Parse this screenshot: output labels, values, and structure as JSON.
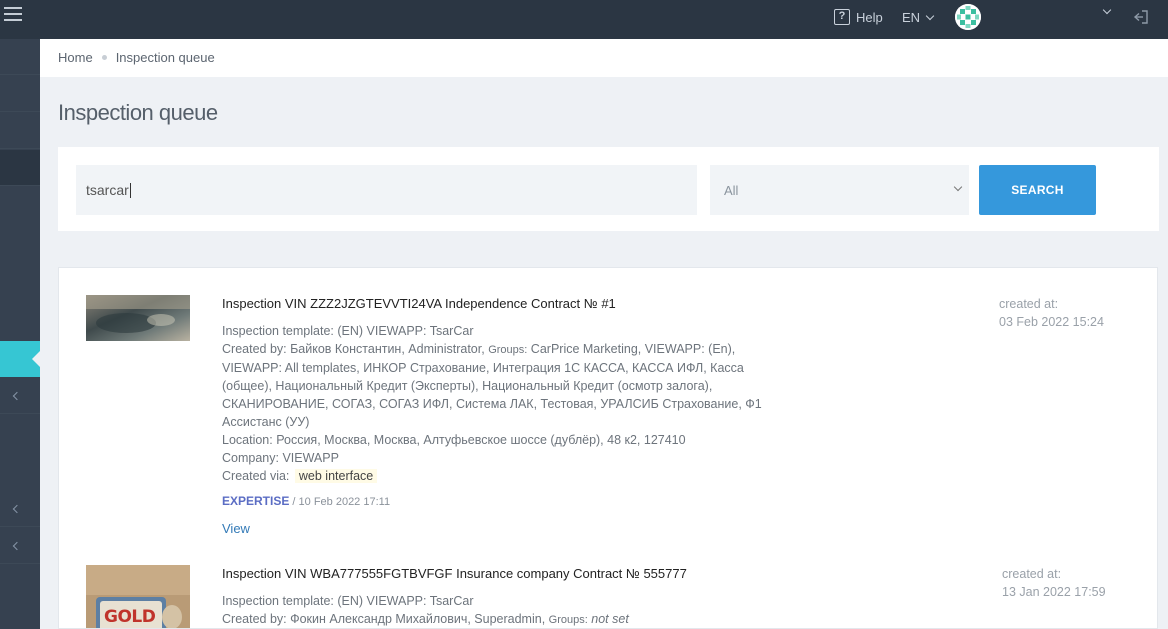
{
  "topbar": {
    "help_label": "Help",
    "lang_label": "EN",
    "icons": [
      "hamburger-icon",
      "help-icon",
      "chevron-down-icon",
      "avatar",
      "logout-icon"
    ]
  },
  "breadcrumb": {
    "home": "Home",
    "current": "Inspection queue"
  },
  "page_title": "Inspection queue",
  "search": {
    "value": "tsarcar",
    "filter_selected": "All",
    "button_label": "SEARCH"
  },
  "results": [
    {
      "title": "Inspection VIN ZZZ2JZGTEVVTI24VA Independence Contract № #1",
      "template": "Inspection template: (EN) VIEWAPP: TsarCar",
      "created_by_prefix": "Created by: Байков Константин, Administrator, ",
      "groups_label": "Groups:",
      "groups_line1": " CarPrice Marketing, VIEWAPP: (En),",
      "groups_line2": "VIEWAPP: All templates, ИНКОР Страхование, Интеграция 1С КАССА, КАССА ИФЛ, Касса",
      "groups_line3": "(общее), Национальный Кредит (Эксперты), Национальный Кредит (осмотр залога),",
      "groups_line4": "СКАНИРОВАНИЕ, СОГАЗ, СОГАЗ ИФЛ, Система ЛАК, Тестовая, УРАЛСИБ Страхование, Ф1",
      "groups_line5": "Ассистанс (УУ)",
      "location": "Location: Россия, Москва, Москва, Алтуфьевское шоссе (дублёр), 48 к2, 127410",
      "company": "Company: VIEWAPP",
      "created_via_label": "Created via:",
      "created_via": "web interface",
      "expertise_label": "EXPERTISE",
      "expertise_date": " / 10 Feb 2022 17:11",
      "view_label": "View",
      "created_at_label": "created at:",
      "created_at": "03 Feb 2022 15:24"
    },
    {
      "title": "Inspection VIN WBA777555FGTBVFGF Insurance company Contract № 555777",
      "template": "Inspection template: (EN) VIEWAPP: TsarCar",
      "created_by_prefix": "Created by: Фокин Александр Михайлович, Superadmin, ",
      "groups_label": "Groups:",
      "groups_value": "not set",
      "thumb_text": "GOLD",
      "created_at_label": "created at:",
      "created_at": "13 Jan 2022 17:59"
    }
  ],
  "colors": {
    "topbar": "#2b3643",
    "sidebar": "#364150",
    "sidebar_active": "#36c6d3",
    "search_button": "#3598dc",
    "expertise": "#5b6dc4",
    "link": "#337ab7"
  }
}
